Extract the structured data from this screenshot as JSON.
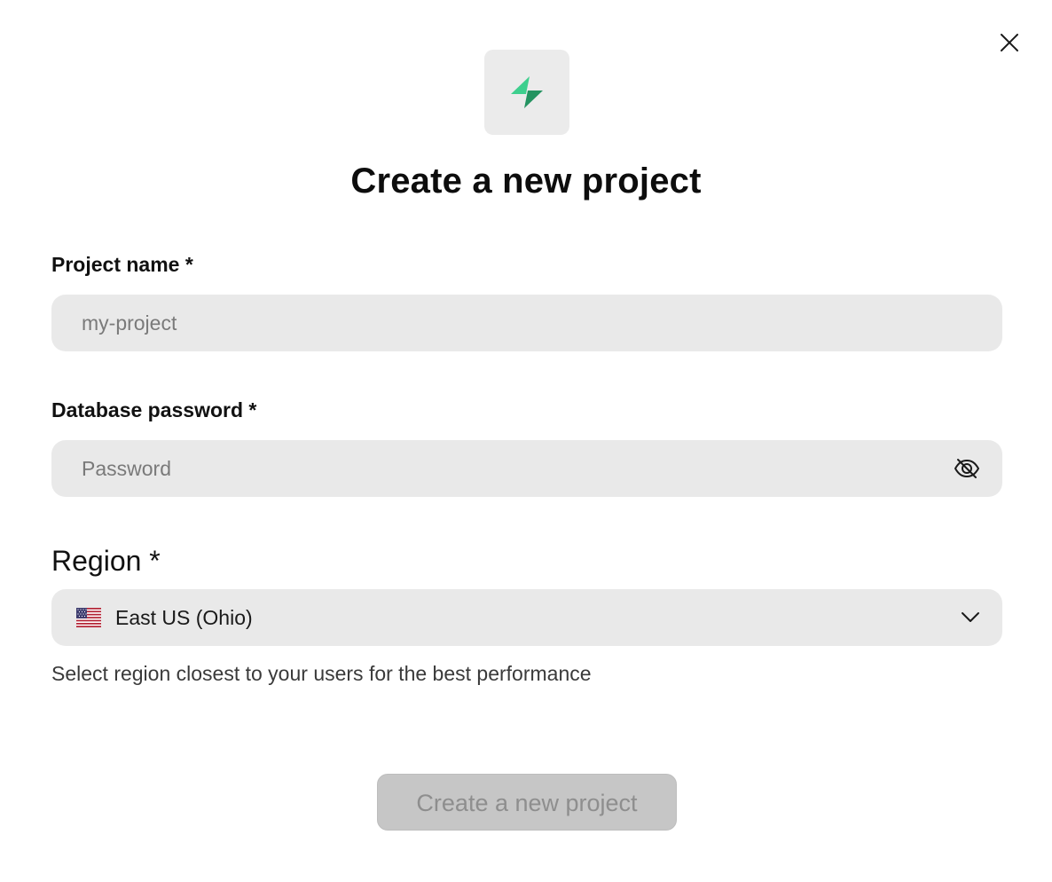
{
  "dialog": {
    "title": "Create a new project",
    "close_icon": "close-icon",
    "logo_icon": "bolt-logo-icon",
    "brand_color": "#3ecf8e"
  },
  "fields": {
    "project_name": {
      "label": "Project name *",
      "value": "",
      "placeholder": "my-project"
    },
    "database_password": {
      "label": "Database password *",
      "value": "",
      "placeholder": "Password",
      "toggle_icon": "eye-off-icon"
    },
    "region": {
      "label": "Region *",
      "selected": "East US (Ohio)",
      "flag_icon": "us-flag-icon",
      "chevron_icon": "chevron-down-icon",
      "helper": "Select region closest to your users for the best performance"
    }
  },
  "actions": {
    "submit_label": "Create a new project",
    "submit_state": "disabled"
  }
}
